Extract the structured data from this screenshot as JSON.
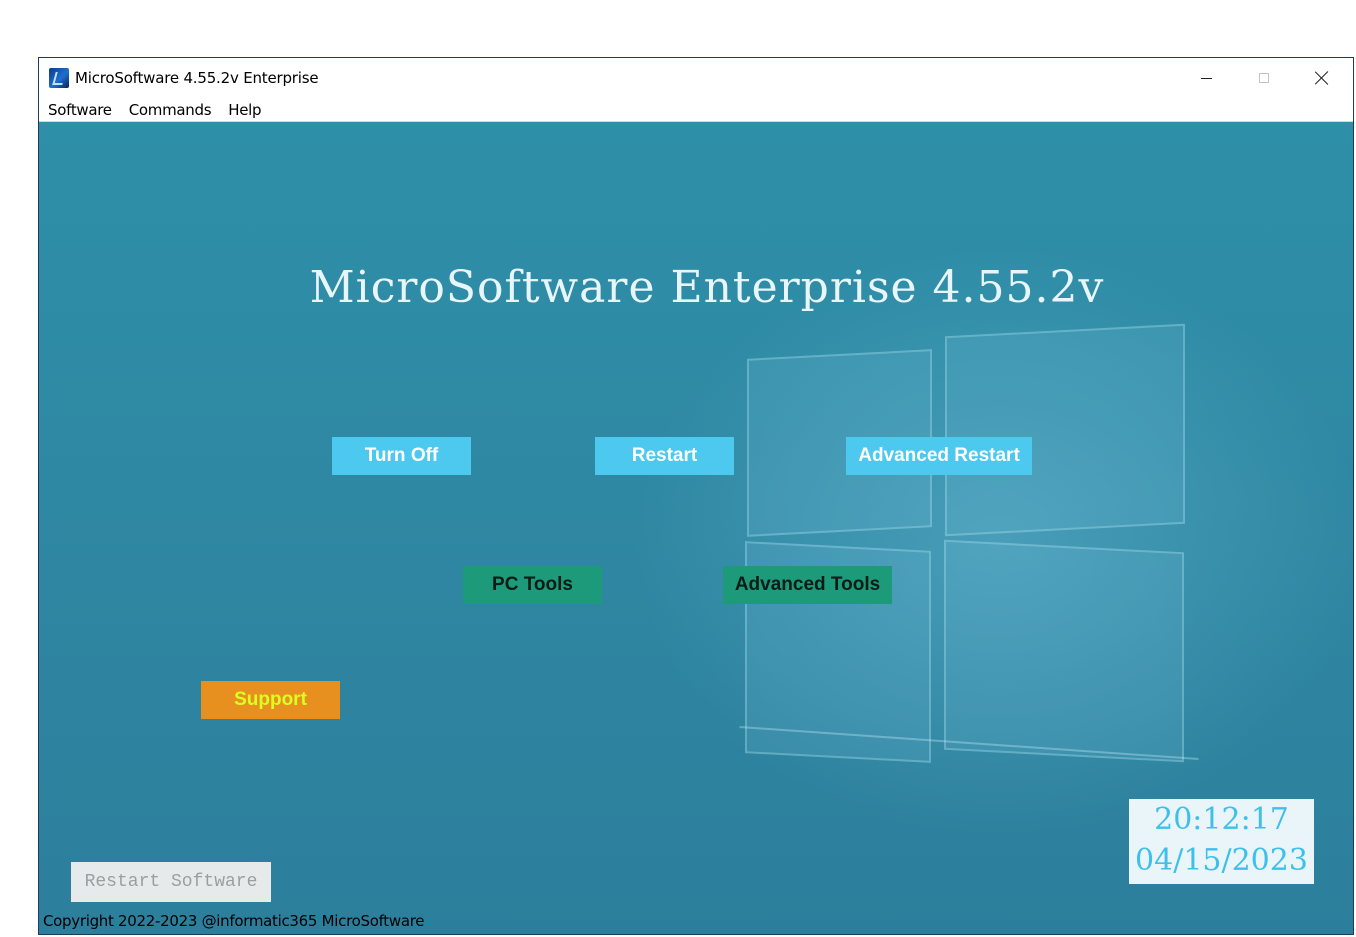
{
  "window": {
    "title": "MicroSoftware 4.55.2v Enterprise"
  },
  "menu": {
    "items": [
      "Software",
      "Commands",
      "Help"
    ]
  },
  "main": {
    "heading": "MicroSoftware Enterprise 4.55.2v",
    "buttons": {
      "turn_off": "Turn Off",
      "restart": "Restart",
      "advanced_restart": "Advanced Restart",
      "pc_tools": "PC Tools",
      "advanced_tools": "Advanced Tools",
      "support": "Support",
      "restart_software": "Restart Software"
    },
    "clock": {
      "time": "20:12:17",
      "date": "04/15/2023"
    },
    "copyright": "Copyright 2022-2023 @informatic365 MicroSoftware"
  },
  "colors": {
    "background": "#2e8fa8",
    "primary_button": "#4dc9f0",
    "tools_button": "#1d9a7a",
    "support_button": "#e8901f",
    "support_text": "#d7ff20",
    "clock_text": "#3fc0ec"
  },
  "icons": {
    "app": "microsoftware-app-icon",
    "minimize": "minimize-icon",
    "maximize": "maximize-icon",
    "close": "close-icon"
  }
}
